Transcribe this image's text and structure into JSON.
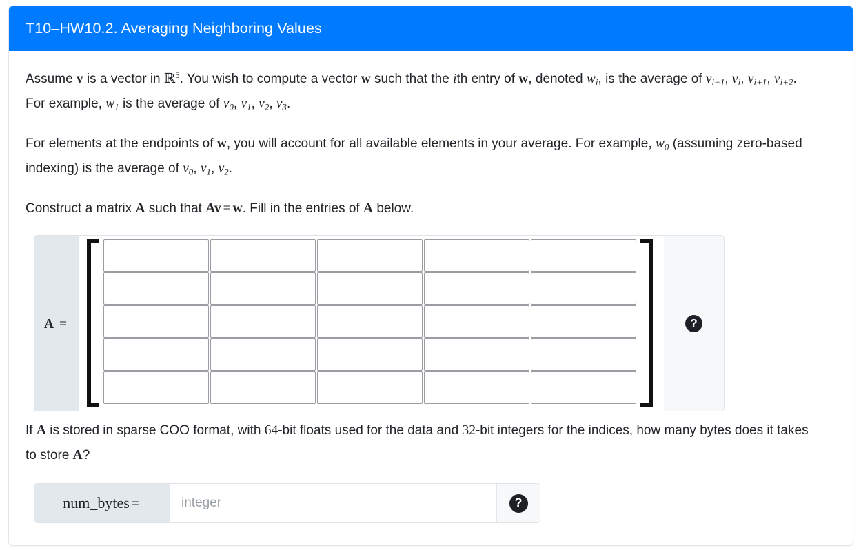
{
  "header": {
    "title": "T10–HW10.2. Averaging Neighboring Values",
    "background_color": "#007bff",
    "text_color": "#ffffff"
  },
  "body": {
    "paragraph1": {
      "segments": [
        "Assume ",
        "v",
        " is a vector in ",
        "R",
        "5",
        ". You wish to compute a vector ",
        "w",
        " such that the ",
        "i",
        "th entry of ",
        "w",
        ", denoted ",
        "w",
        "i",
        ", is the average of ",
        "v",
        "i−1",
        ", ",
        "v",
        "i",
        ", ",
        "v",
        "i+1",
        ", ",
        "v",
        "i+2",
        ". For example, ",
        "w",
        "1",
        " is the average of ",
        "v",
        "0",
        ", ",
        "v",
        "1",
        ", ",
        "v",
        "2",
        ", ",
        "v",
        "3",
        "."
      ],
      "plain_text": "Assume v is a vector in R^5. You wish to compute a vector w such that the ith entry of w, denoted w_i, is the average of v_{i-1}, v_i, v_{i+1}, v_{i+2}. For example, w_1 is the average of v_0, v_1, v_2, v_3."
    },
    "paragraph2": {
      "plain_text": "For elements at the endpoints of w, you will account for all available elements in your average. For example, w_0 (assuming zero-based indexing) is the average of v_0, v_1, v_2."
    },
    "paragraph3": {
      "plain_text": "Construct a matrix A such that Av = w. Fill in the entries of A below."
    },
    "paragraph4": {
      "plain_text": "If A is stored in sparse COO format, with 64-bit floats used for the data and 32-bit integers for the indices, how many bytes does it takes to store A?"
    }
  },
  "matrix_input": {
    "label": "A",
    "equals": "=",
    "rows": 5,
    "cols": 5,
    "cell_placeholder": "",
    "cells": [
      [
        "",
        "",
        "",
        "",
        ""
      ],
      [
        "",
        "",
        "",
        "",
        ""
      ],
      [
        "",
        "",
        "",
        "",
        ""
      ],
      [
        "",
        "",
        "",
        "",
        ""
      ],
      [
        "",
        "",
        "",
        "",
        ""
      ]
    ],
    "help_glyph": "?",
    "label_background": "#e3e8ec",
    "help_background": "#f7f8fa"
  },
  "num_bytes_input": {
    "label": "num_bytes",
    "equals": "=",
    "value": "",
    "placeholder": "integer",
    "help_glyph": "?"
  },
  "literals": {
    "bit64": "64",
    "bit32": "32",
    "sparse_format": "COO"
  }
}
